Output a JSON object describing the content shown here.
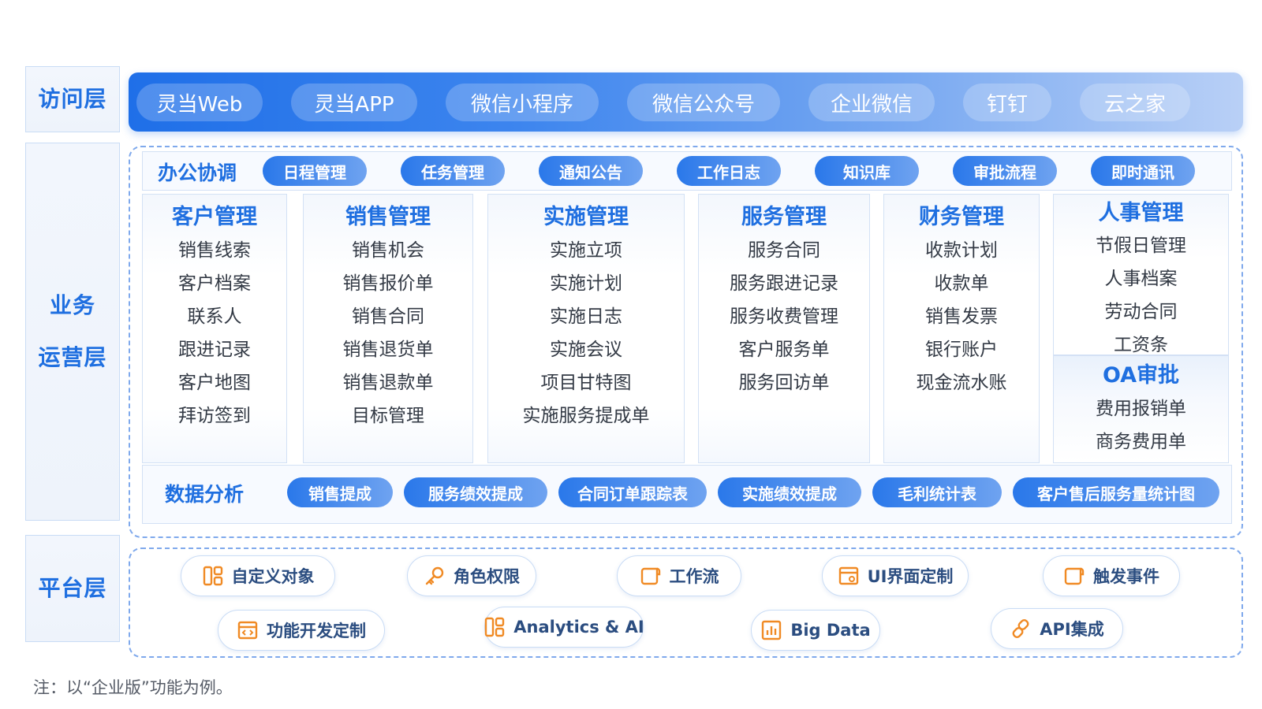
{
  "layers": {
    "access": "访问层",
    "business_line1": "业务",
    "business_line2": "运营层",
    "platform": "平台层"
  },
  "access_items": [
    "灵当Web",
    "灵当APP",
    "微信小程序",
    "微信公众号",
    "企业微信",
    "钉钉",
    "云之家"
  ],
  "office": {
    "title": "办公协调",
    "items": [
      "日程管理",
      "任务管理",
      "通知公告",
      "工作日志",
      "知识库",
      "审批流程",
      "即时通讯"
    ]
  },
  "modules": [
    {
      "title": "客户管理",
      "items": [
        "销售线索",
        "客户档案",
        "联系人",
        "跟进记录",
        "客户地图",
        "拜访签到"
      ]
    },
    {
      "title": "销售管理",
      "items": [
        "销售机会",
        "销售报价单",
        "销售合同",
        "销售退货单",
        "销售退款单",
        "目标管理"
      ]
    },
    {
      "title": "实施管理",
      "items": [
        "实施立项",
        "实施计划",
        "实施日志",
        "实施会议",
        "项目甘特图",
        "实施服务提成单"
      ]
    },
    {
      "title": "服务管理",
      "items": [
        "服务合同",
        "服务跟进记录",
        "服务收费管理",
        "客户服务单",
        "服务回访单"
      ]
    },
    {
      "title": "财务管理",
      "items": [
        "收款计划",
        "收款单",
        "销售发票",
        "银行账户",
        "现金流水账"
      ]
    }
  ],
  "hr": {
    "title": "人事管理",
    "items": [
      "节假日管理",
      "人事档案",
      "劳动合同",
      "工资条"
    ]
  },
  "oa": {
    "title": "OA审批",
    "items": [
      "费用报销单",
      "商务费用单"
    ]
  },
  "data_analysis": {
    "title": "数据分析",
    "items": [
      "销售提成",
      "服务绩效提成",
      "合同订单跟踪表",
      "实施绩效提成",
      "毛利统计表",
      "客户售后服务量统计图"
    ]
  },
  "platform_items": [
    {
      "label": "自定义对象",
      "icon": "blocks-icon"
    },
    {
      "label": "角色权限",
      "icon": "key-icon"
    },
    {
      "label": "工作流",
      "icon": "scroll-icon"
    },
    {
      "label": "UI界面定制",
      "icon": "ui-window-icon"
    },
    {
      "label": "触发事件",
      "icon": "scroll-icon"
    },
    {
      "label": "功能开发定制",
      "icon": "code-window-icon"
    },
    {
      "label": "Analytics & AI",
      "icon": "blocks-icon"
    },
    {
      "label": "Big Data",
      "icon": "bar-chart-icon"
    },
    {
      "label": "API集成",
      "icon": "link-icon"
    }
  ],
  "colors": {
    "accent": "#1f6fe0",
    "icon_orange": "#f08a24"
  },
  "footnote": "注：以“企业版”功能为例。"
}
